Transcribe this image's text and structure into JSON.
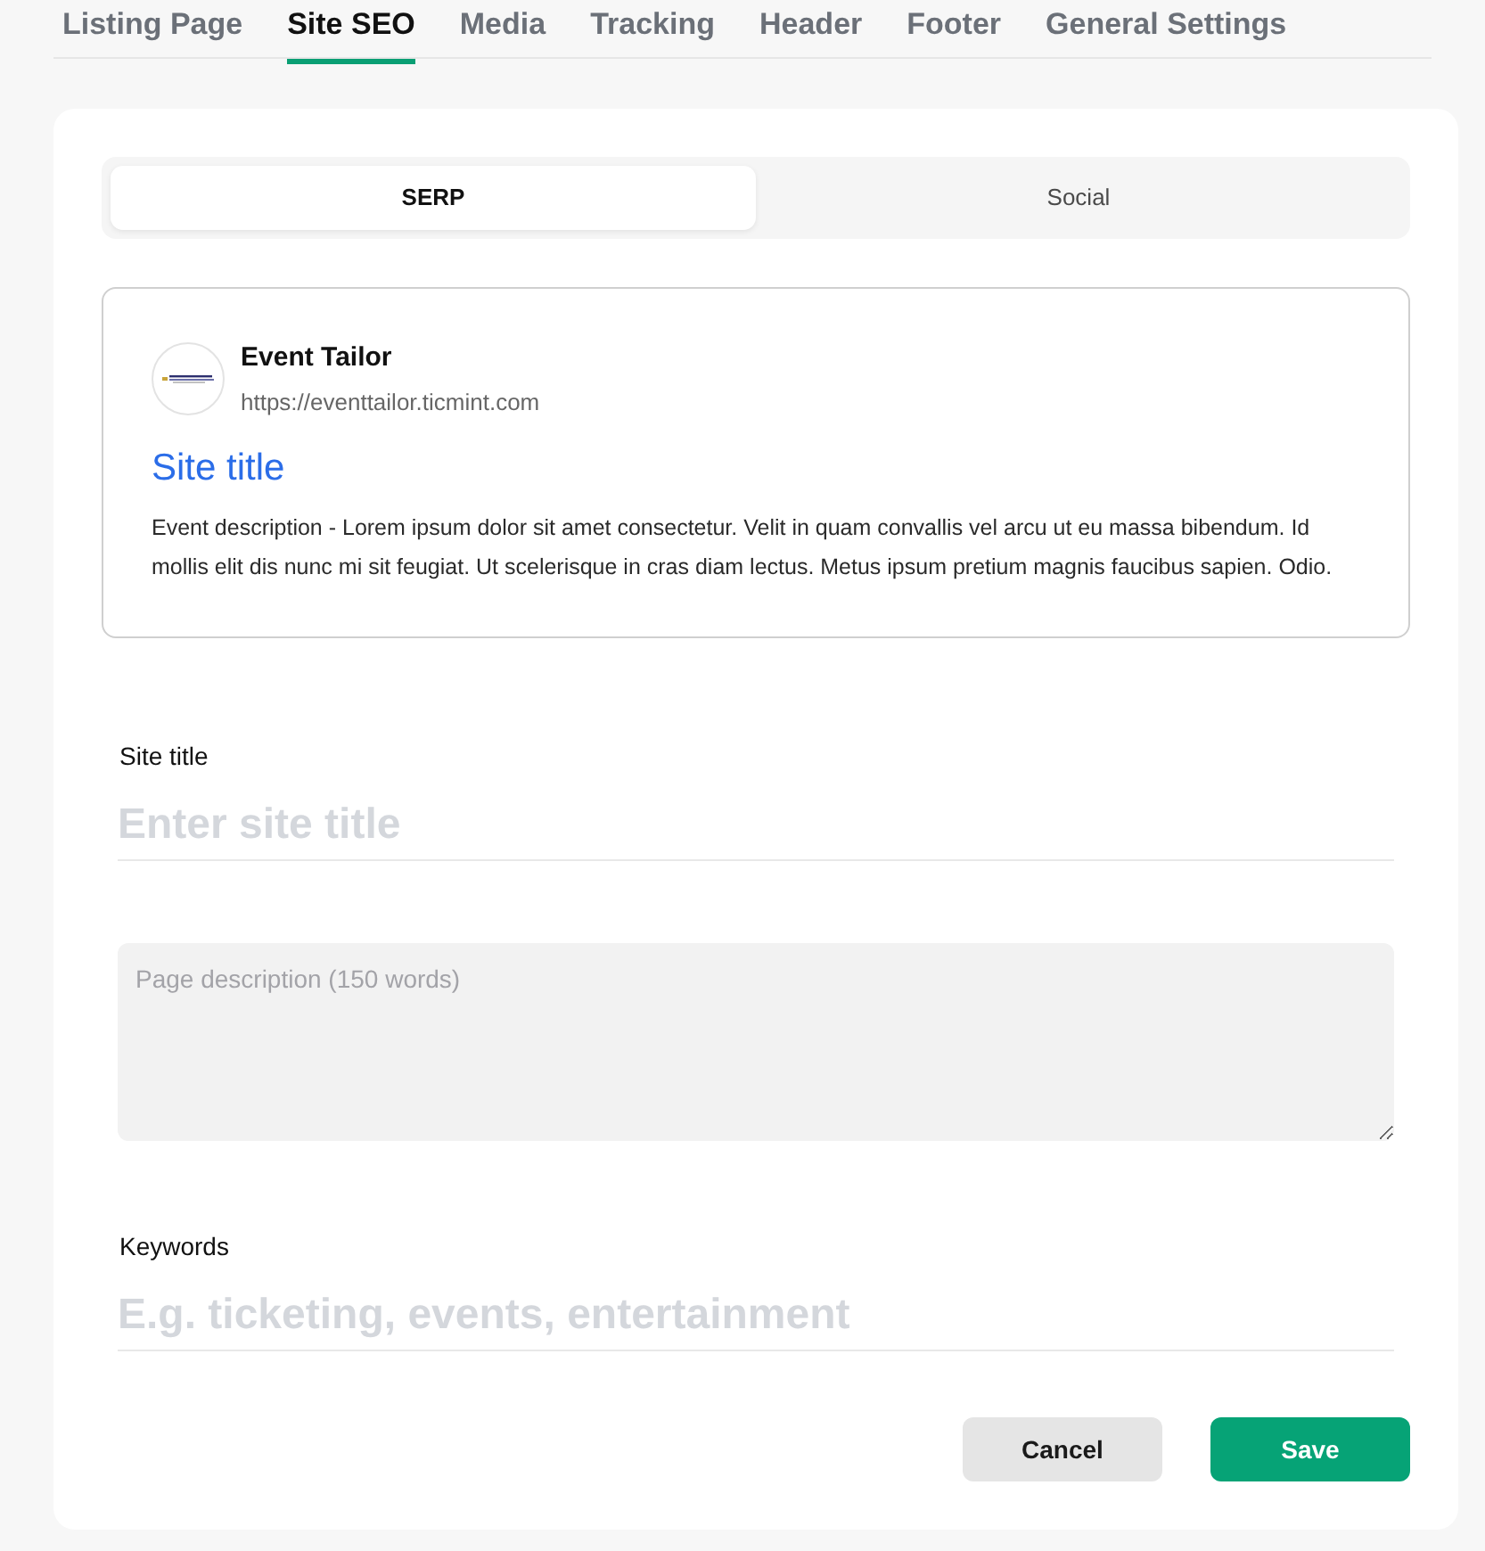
{
  "top_tabs": [
    {
      "label": "Listing Page",
      "selected": false
    },
    {
      "label": "Site SEO",
      "selected": true
    },
    {
      "label": "Media",
      "selected": false
    },
    {
      "label": "Tracking",
      "selected": false
    },
    {
      "label": "Header",
      "selected": false
    },
    {
      "label": "Footer",
      "selected": false
    },
    {
      "label": "General Settings",
      "selected": false
    }
  ],
  "sub_tabs": [
    {
      "label": "SERP",
      "selected": true
    },
    {
      "label": "Social",
      "selected": false
    }
  ],
  "preview": {
    "site_name": "Event Tailor",
    "url": "https://eventtailor.ticmint.com",
    "title": "Site title",
    "description": "Event description - Lorem ipsum dolor sit amet consectetur. Velit in quam convallis vel arcu ut eu massa bibendum. Id mollis elit dis nunc mi sit feugiat. Ut scelerisque in cras diam lectus. Metus ipsum pretium magnis faucibus sapien. Odio."
  },
  "fields": [
    {
      "kind": "line",
      "label": "Site title",
      "placeholder": "Enter site title"
    },
    {
      "kind": "area",
      "placeholder": "Page description (150 words)"
    },
    {
      "kind": "line",
      "label": "Keywords",
      "placeholder": "E.g. ticketing, events, entertainment"
    }
  ],
  "buttons": [
    {
      "kind": "secondary",
      "label": "Cancel"
    },
    {
      "kind": "primary",
      "label": "Save"
    }
  ]
}
